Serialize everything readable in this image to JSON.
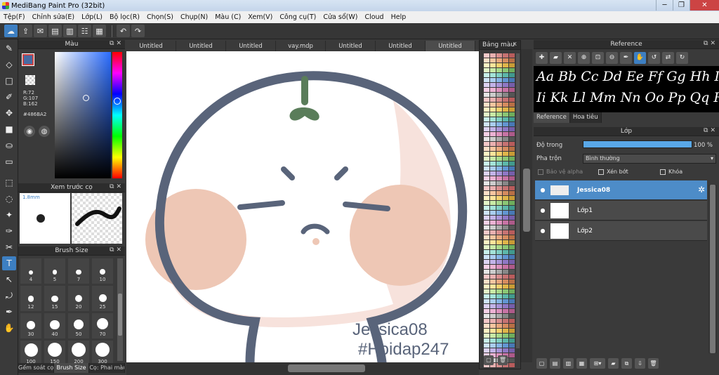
{
  "window": {
    "title": "MediBang Paint Pro (32bit)",
    "min": "─",
    "max": "❐",
    "close": "✕"
  },
  "menu": [
    "Tệp(F)",
    "Chỉnh sửa(E)",
    "Lớp(L)",
    "Bộ lọc(R)",
    "Chọn(S)",
    "Chụp(N)",
    "Màu (C)",
    "Xem(V)",
    "Công cụ(T)",
    "Cửa sổ(W)",
    "Cloud",
    "Help"
  ],
  "color_panel": {
    "title": "Màu",
    "r": "R:72",
    "g": "G:107",
    "b": "B:162",
    "hex": "#486BA2",
    "fg_color": "#486BA2"
  },
  "preview_panel": {
    "title": "Xem trước cọ",
    "size": "1.8mm"
  },
  "brush_panel": {
    "title": "Brush Size",
    "sizes": [
      "4",
      "5",
      "7",
      "10",
      "12",
      "15",
      "20",
      "25",
      "30",
      "40",
      "50",
      "70",
      "100",
      "150",
      "200",
      "300"
    ],
    "tabs": [
      "Gếm soát cọ",
      "Brush Size",
      "Cọ: Phai màu"
    ]
  },
  "doc_tabs": [
    "Untitled",
    "Untitled",
    "Untitled",
    "vay.mdp",
    "Untitled",
    "Untitled",
    "Untitled"
  ],
  "canvas": {
    "sig1": "Jessica08",
    "sig2": "#Hoidap247"
  },
  "swatch_panel": {
    "title": "Bảng màu",
    "close": "x"
  },
  "reference_panel": {
    "title": "Reference",
    "line1": "Aa Bb Cc Dd Ee Ff Gg Hh Ii",
    "line2": "Ii Kk Ll Mm Nn Oo Pp Qq Rr",
    "tabs": [
      "Reference",
      "Hoa tiêu"
    ]
  },
  "layer_panel": {
    "title": "Lớp",
    "opacity_label": "Độ trong",
    "opacity_value": "100 %",
    "opacity": 1.0,
    "blend_label": "Pha trộn",
    "blend_value": "Bình thường",
    "protect_alpha": "Bảo vệ alpha",
    "clipping": "Xén bớt",
    "lock": "Khóa",
    "layers": [
      "Jessica08",
      "Lớp1",
      "Lớp2"
    ]
  }
}
